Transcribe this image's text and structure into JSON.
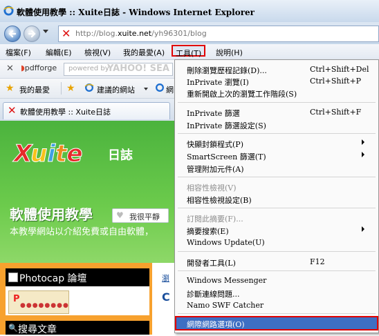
{
  "window": {
    "title": "軟體使用教學 :: Xuite日誌 - Windows Internet Explorer"
  },
  "address": {
    "url_prefix": "http://blog.",
    "url_domain": "xuite.net",
    "url_path": "/yh96301/blog"
  },
  "menubar": [
    "檔案(F)",
    "編輯(E)",
    "檢視(V)",
    "我的最愛(A)",
    "工具(T)",
    "說明(H)"
  ],
  "pdfforge": {
    "logo": "pdfforge",
    "search_placeholder": "powered by",
    "search_brand": "YAHOO! SEA"
  },
  "favorites": {
    "label": "我的最愛",
    "suggested": "建議的網站",
    "more": "網"
  },
  "tab": {
    "title": "軟體使用教學 :: Xuite日誌"
  },
  "page": {
    "logo_sub": "日誌",
    "blog_title": "軟體使用教學",
    "like_label": "我很平靜",
    "blog_desc": "本教學網站以介紹免費或自由軟體，",
    "box1_title": "Photocap 論壇",
    "box2_title": "搜尋文章",
    "right_link": "瀏",
    "right_c": "C"
  },
  "tools_menu": {
    "items": [
      {
        "label": "刪除瀏覽歷程記錄(D)...",
        "shortcut": "Ctrl+Shift+Del"
      },
      {
        "label": "InPrivate 瀏覽(I)",
        "shortcut": "Ctrl+Shift+P"
      },
      {
        "label": "重新開啟上次的瀏覽工作階段(S)",
        "shortcut": ""
      },
      {
        "label": "InPrivate 篩選",
        "shortcut": "Ctrl+Shift+F"
      },
      {
        "label": "InPrivate 篩選設定(S)",
        "shortcut": ""
      },
      {
        "label": "快顯封鎖程式(P)",
        "shortcut": ""
      },
      {
        "label": "SmartScreen 篩選(T)",
        "shortcut": ""
      },
      {
        "label": "管理附加元件(A)",
        "shortcut": ""
      },
      {
        "label": "相容性檢視(V)",
        "shortcut": ""
      },
      {
        "label": "相容性檢視設定(B)",
        "shortcut": ""
      },
      {
        "label": "訂閱此摘要(F)...",
        "shortcut": ""
      },
      {
        "label": "摘要搜索(E)",
        "shortcut": ""
      },
      {
        "label": "Windows Update(U)",
        "shortcut": ""
      },
      {
        "label": "開發者工具(L)",
        "shortcut": "F12"
      },
      {
        "label": "Windows Messenger",
        "shortcut": ""
      },
      {
        "label": "診斷連線問題...",
        "shortcut": ""
      },
      {
        "label": "Namo SWF Catcher",
        "shortcut": ""
      },
      {
        "label": "網際網路選項(O)",
        "shortcut": ""
      }
    ]
  },
  "colors": {
    "highlight": "#3e6fc3",
    "callout": "#e00000",
    "page_green": "#5abf45",
    "sidebar_orange": "#f7a12e"
  }
}
